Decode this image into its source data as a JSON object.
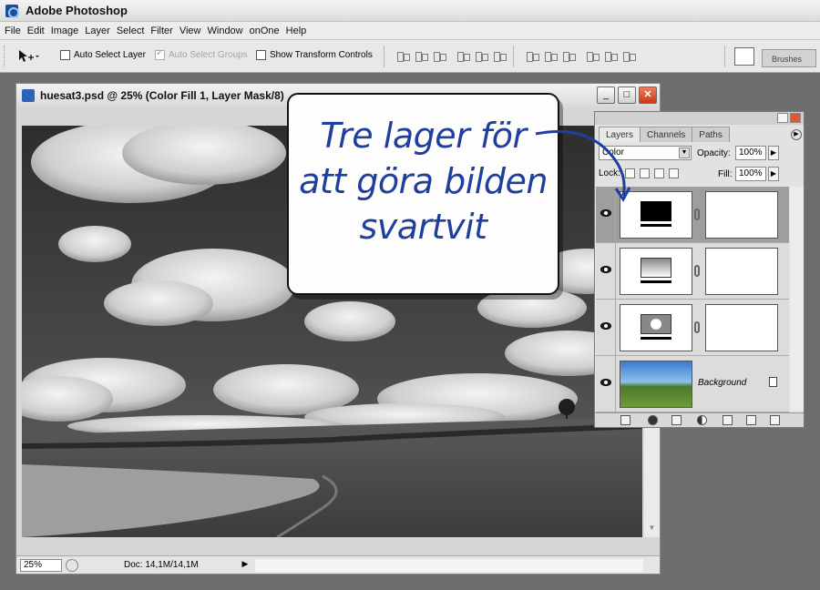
{
  "app": {
    "title": "Adobe Photoshop"
  },
  "menu": [
    "File",
    "Edit",
    "Image",
    "Layer",
    "Select",
    "Filter",
    "View",
    "Window",
    "onOne",
    "Help"
  ],
  "options": {
    "auto_select_layer": "Auto Select Layer",
    "auto_select_groups": "Auto Select Groups",
    "show_transform_controls": "Show Transform Controls",
    "brushes_tab": "Brushes"
  },
  "document": {
    "title": "huesat3.psd @ 25% (Color Fill 1, Layer Mask/8)",
    "zoom": "25%",
    "doc_size": "Doc: 14,1M/14,1M",
    "win_buttons": {
      "minimize": "_",
      "maximize": "□",
      "close": "✕"
    }
  },
  "layers_panel": {
    "tabs": [
      "Layers",
      "Channels",
      "Paths"
    ],
    "blend_mode": "Color",
    "opacity_label": "Opacity:",
    "opacity": "100%",
    "lock_label": "Lock:",
    "fill_label": "Fill:",
    "fill": "100%",
    "layers": [
      {
        "name": "",
        "thumb": "color-fill",
        "selected": true
      },
      {
        "name": "",
        "thumb": "gradient-fill",
        "selected": false
      },
      {
        "name": "",
        "thumb": "adjustment",
        "selected": false
      },
      {
        "name": "Background",
        "thumb": "photo",
        "selected": false
      }
    ]
  },
  "callout": {
    "lines": [
      "Tre lager för",
      "att göra bilden",
      "svartvit"
    ],
    "color": "#1f3f9f"
  },
  "colors": {
    "callout_text": "#1f3f9f",
    "close_button": "#d9482a"
  }
}
